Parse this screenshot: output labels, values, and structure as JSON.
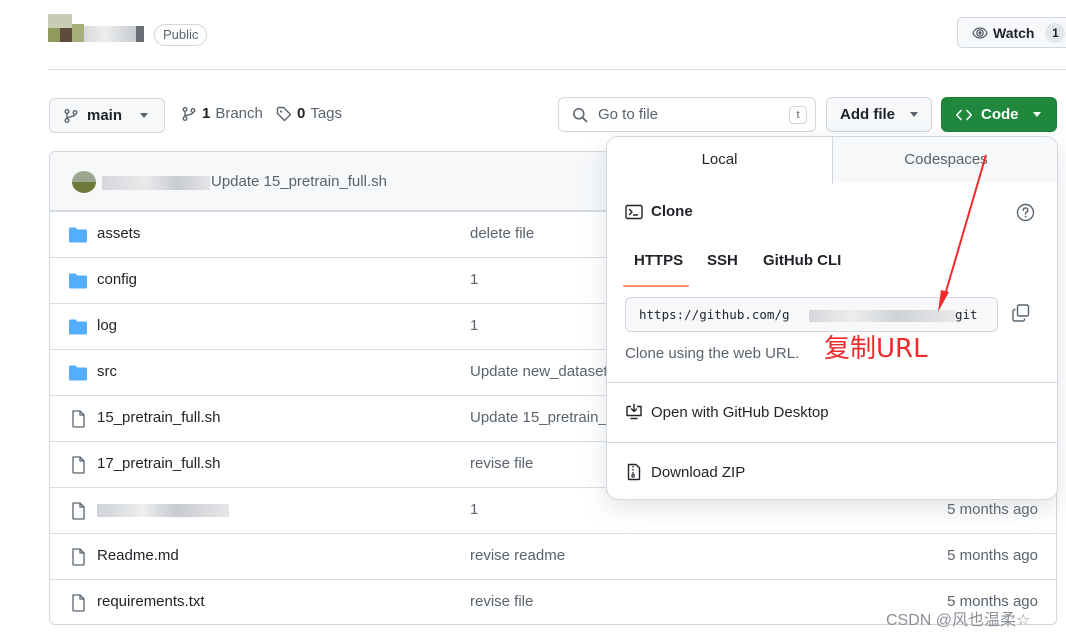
{
  "header": {
    "visibility_badge": "Public",
    "watch": {
      "label": "Watch",
      "count": "1"
    }
  },
  "toolbar": {
    "branch_label": "main",
    "branches_count": "1",
    "branches_label": "Branch",
    "tags_count": "0",
    "tags_label": "Tags",
    "goto_placeholder": "Go to file",
    "goto_shortcut": "t",
    "add_file_label": "Add file",
    "code_label": "Code"
  },
  "latest_commit": {
    "message": "Update 15_pretrain_full.sh"
  },
  "files": [
    {
      "type": "folder",
      "name": "assets",
      "commit": "delete file",
      "age": ""
    },
    {
      "type": "folder",
      "name": "config",
      "commit": "1",
      "age": ""
    },
    {
      "type": "folder",
      "name": "log",
      "commit": "1",
      "age": ""
    },
    {
      "type": "folder",
      "name": "src",
      "commit": "Update new_dataset",
      "age": ""
    },
    {
      "type": "file",
      "name": "15_pretrain_full.sh",
      "commit": "Update 15_pretrain_",
      "age": ""
    },
    {
      "type": "file",
      "name": "17_pretrain_full.sh",
      "commit": "revise file",
      "age": ""
    },
    {
      "type": "file",
      "name": "",
      "commit": "1",
      "age": "5 months ago"
    },
    {
      "type": "file",
      "name": "Readme.md",
      "commit": "revise readme",
      "age": "5 months ago"
    },
    {
      "type": "file",
      "name": "requirements.txt",
      "commit": "revise file",
      "age": "5 months ago"
    }
  ],
  "clone_panel": {
    "tabs": [
      "Local",
      "Codespaces"
    ],
    "clone_title": "Clone",
    "protocols": [
      "HTTPS",
      "SSH",
      "GitHub CLI"
    ],
    "url_prefix": "https://github.com/g",
    "url_suffix": "git",
    "hint": "Clone using the web URL.",
    "open_desktop": "Open with GitHub Desktop",
    "download_zip": "Download ZIP"
  },
  "annotation": {
    "text": "复制URL",
    "color": "#ee2a2a"
  },
  "watermark": "CSDN @风也温柔☆",
  "colors": {
    "primary_button": "#1f883d",
    "folder_icon": "#54aeff",
    "tab_underline": "#fd8c73"
  }
}
